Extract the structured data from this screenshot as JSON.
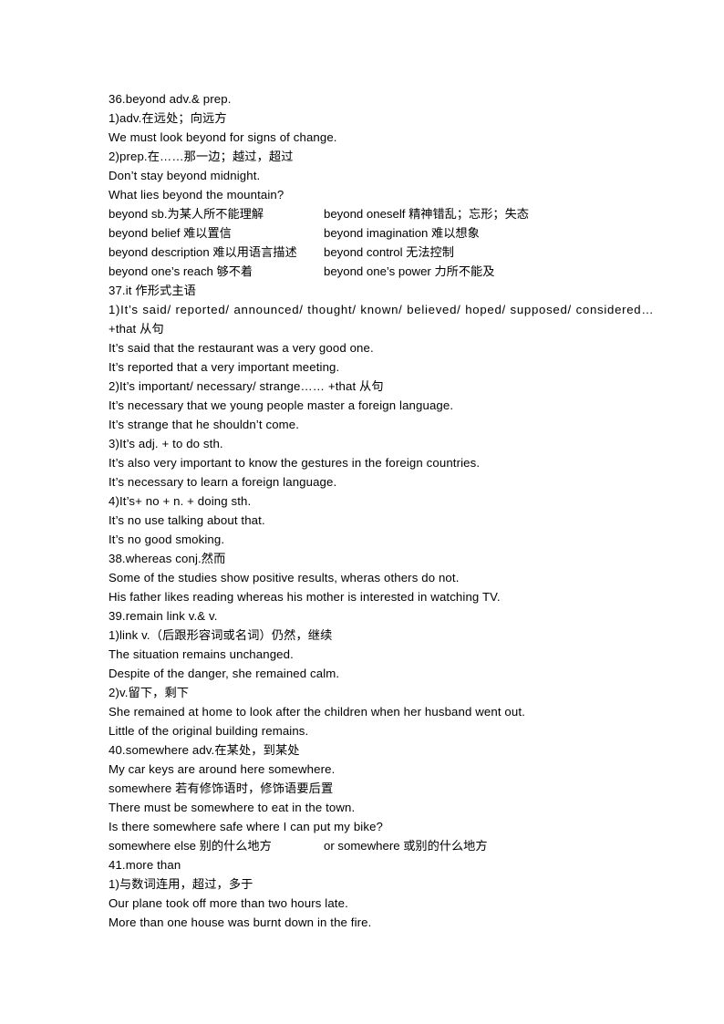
{
  "document": {
    "entries": [
      {
        "id": "entry-36",
        "lines": [
          {
            "type": "text",
            "text": "36.beyond adv.& prep."
          },
          {
            "type": "text",
            "text": "1)adv.在远处；向远方"
          },
          {
            "type": "text",
            "text": "We must look beyond for signs of change."
          },
          {
            "type": "text",
            "text": "2)prep.在……那一边；越过，超过"
          },
          {
            "type": "text",
            "text": "Don’t stay beyond midnight."
          },
          {
            "type": "text",
            "text": "What lies beyond the mountain?"
          },
          {
            "type": "two-col",
            "left": "beyond sb.为某人所不能理解",
            "right": "beyond oneself 精神错乱；忘形；失态"
          },
          {
            "type": "two-col",
            "left": "beyond belief 难以置信",
            "right": "beyond imagination 难以想象"
          },
          {
            "type": "two-col",
            "left": "beyond description 难以用语言描述",
            "right": "beyond control 无法控制"
          },
          {
            "type": "two-col",
            "left": "beyond one’s reach 够不着",
            "right": "beyond one’s power 力所不能及"
          }
        ]
      },
      {
        "id": "entry-37",
        "lines": [
          {
            "type": "text",
            "text": "37.it 作形式主语"
          },
          {
            "type": "stretched",
            "text": "1)It’s said/ reported/ announced/ thought/ known/ believed/ hoped/ supposed/ considered…"
          },
          {
            "type": "text",
            "text": "+that 从句"
          },
          {
            "type": "text",
            "text": "It’s said that the restaurant was a very good one."
          },
          {
            "type": "text",
            "text": "It’s reported that a very important meeting."
          },
          {
            "type": "text",
            "text": "2)It’s important/ necessary/ strange…… +that 从句"
          },
          {
            "type": "text",
            "text": "It’s necessary that we young people master a foreign language."
          },
          {
            "type": "text",
            "text": "It’s strange that he shouldn’t come."
          },
          {
            "type": "text",
            "text": "3)It’s adj. + to do sth."
          },
          {
            "type": "text",
            "text": "It’s also very important to know the gestures in the foreign countries."
          },
          {
            "type": "text",
            "text": "It’s necessary to learn a foreign language."
          },
          {
            "type": "text",
            "text": "4)It’s+ no + n. + doing sth."
          },
          {
            "type": "text",
            "text": "It’s no use talking about that."
          },
          {
            "type": "text",
            "text": "It’s no good smoking."
          }
        ]
      },
      {
        "id": "entry-38",
        "lines": [
          {
            "type": "text",
            "text": "38.whereas conj.然而"
          },
          {
            "type": "text",
            "text": "Some of the studies show positive results, wheras others do not."
          },
          {
            "type": "text",
            "text": "His father likes reading whereas his mother is interested in watching TV."
          }
        ]
      },
      {
        "id": "entry-39",
        "lines": [
          {
            "type": "text",
            "text": "39.remain link v.& v."
          },
          {
            "type": "text",
            "text": "1)link v.（后跟形容词或名词）仍然，继续"
          },
          {
            "type": "text",
            "text": "The situation remains unchanged."
          },
          {
            "type": "text",
            "text": "Despite of the danger, she remained calm."
          },
          {
            "type": "text",
            "text": "2)v.留下，剩下"
          },
          {
            "type": "text",
            "text": "She remained at home to look after the children when her husband went out."
          },
          {
            "type": "text",
            "text": "Little of the original building remains."
          }
        ]
      },
      {
        "id": "entry-40",
        "lines": [
          {
            "type": "text",
            "text": "40.somewhere adv.在某处，到某处"
          },
          {
            "type": "text",
            "text": "My car keys are around here somewhere."
          },
          {
            "type": "text",
            "text": "somewhere 若有修饰语时，修饰语要后置"
          },
          {
            "type": "text",
            "text": "There must be somewhere to eat in the town."
          },
          {
            "type": "text",
            "text": "Is there somewhere safe where I can put my bike?"
          },
          {
            "type": "two-col",
            "left": "somewhere else 别的什么地方",
            "right": "or somewhere 或别的什么地方"
          }
        ]
      },
      {
        "id": "entry-41",
        "lines": [
          {
            "type": "text",
            "text": "41.more than"
          },
          {
            "type": "text",
            "text": "1)与数词连用，超过，多于"
          },
          {
            "type": "text",
            "text": "Our plane took off more than two hours late."
          },
          {
            "type": "text",
            "text": "More than one house was burnt down in the fire."
          }
        ]
      }
    ]
  }
}
